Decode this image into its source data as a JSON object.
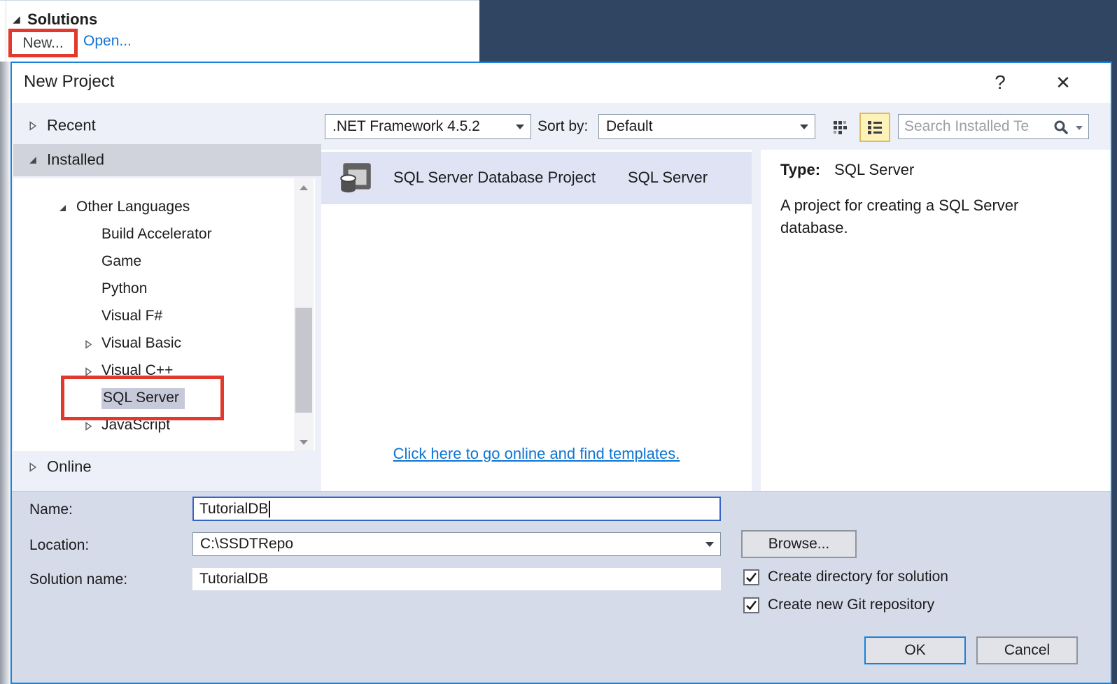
{
  "solutions_panel": {
    "title": "Solutions",
    "new_button": "New...",
    "open_link": "Open..."
  },
  "dialog": {
    "title": "New Project",
    "help_glyph": "?",
    "close_glyph": "✕",
    "toolbar": {
      "framework_value": ".NET Framework 4.5.2",
      "sort_by_label": "Sort by:",
      "sort_value": "Default",
      "search_placeholder": "Search Installed Te"
    },
    "sidebar": {
      "recent_label": "Recent",
      "installed_label": "Installed",
      "online_label": "Online",
      "tree": [
        {
          "label": "Other Languages",
          "state": "expanded"
        },
        {
          "label": "Build Accelerator",
          "state": "leaf"
        },
        {
          "label": "Game",
          "state": "leaf"
        },
        {
          "label": "Python",
          "state": "leaf"
        },
        {
          "label": "Visual F#",
          "state": "leaf"
        },
        {
          "label": "Visual Basic",
          "state": "collapsed"
        },
        {
          "label": "Visual C++",
          "state": "collapsed"
        },
        {
          "label": "SQL Server",
          "state": "leaf",
          "selected": true
        },
        {
          "label": "JavaScript",
          "state": "collapsed"
        }
      ]
    },
    "templates": {
      "selected_name": "SQL Server Database Project",
      "selected_language": "SQL Server",
      "online_link": "Click here to go online and find templates."
    },
    "info": {
      "type_label": "Type:",
      "type_value": "SQL Server",
      "description": "A project for creating a SQL Server database."
    },
    "form": {
      "name_label": "Name:",
      "name_value": "TutorialDB",
      "location_label": "Location:",
      "location_value": "C:\\SSDTRepo",
      "solution_name_label": "Solution name:",
      "solution_name_value": "TutorialDB",
      "browse_button": "Browse...",
      "create_directory_checkbox": {
        "label": "Create directory for solution",
        "checked": true
      },
      "create_git_checkbox": {
        "label": "Create new Git repository",
        "checked": true
      },
      "ok_button": "OK",
      "cancel_button": "Cancel"
    }
  },
  "colors": {
    "highlight_red": "#e1392b",
    "dialog_border_blue": "#1883d9",
    "link_blue": "#0e74d1",
    "background_navy": "#2f4562",
    "active_view_amber": "#fdf2b9"
  }
}
